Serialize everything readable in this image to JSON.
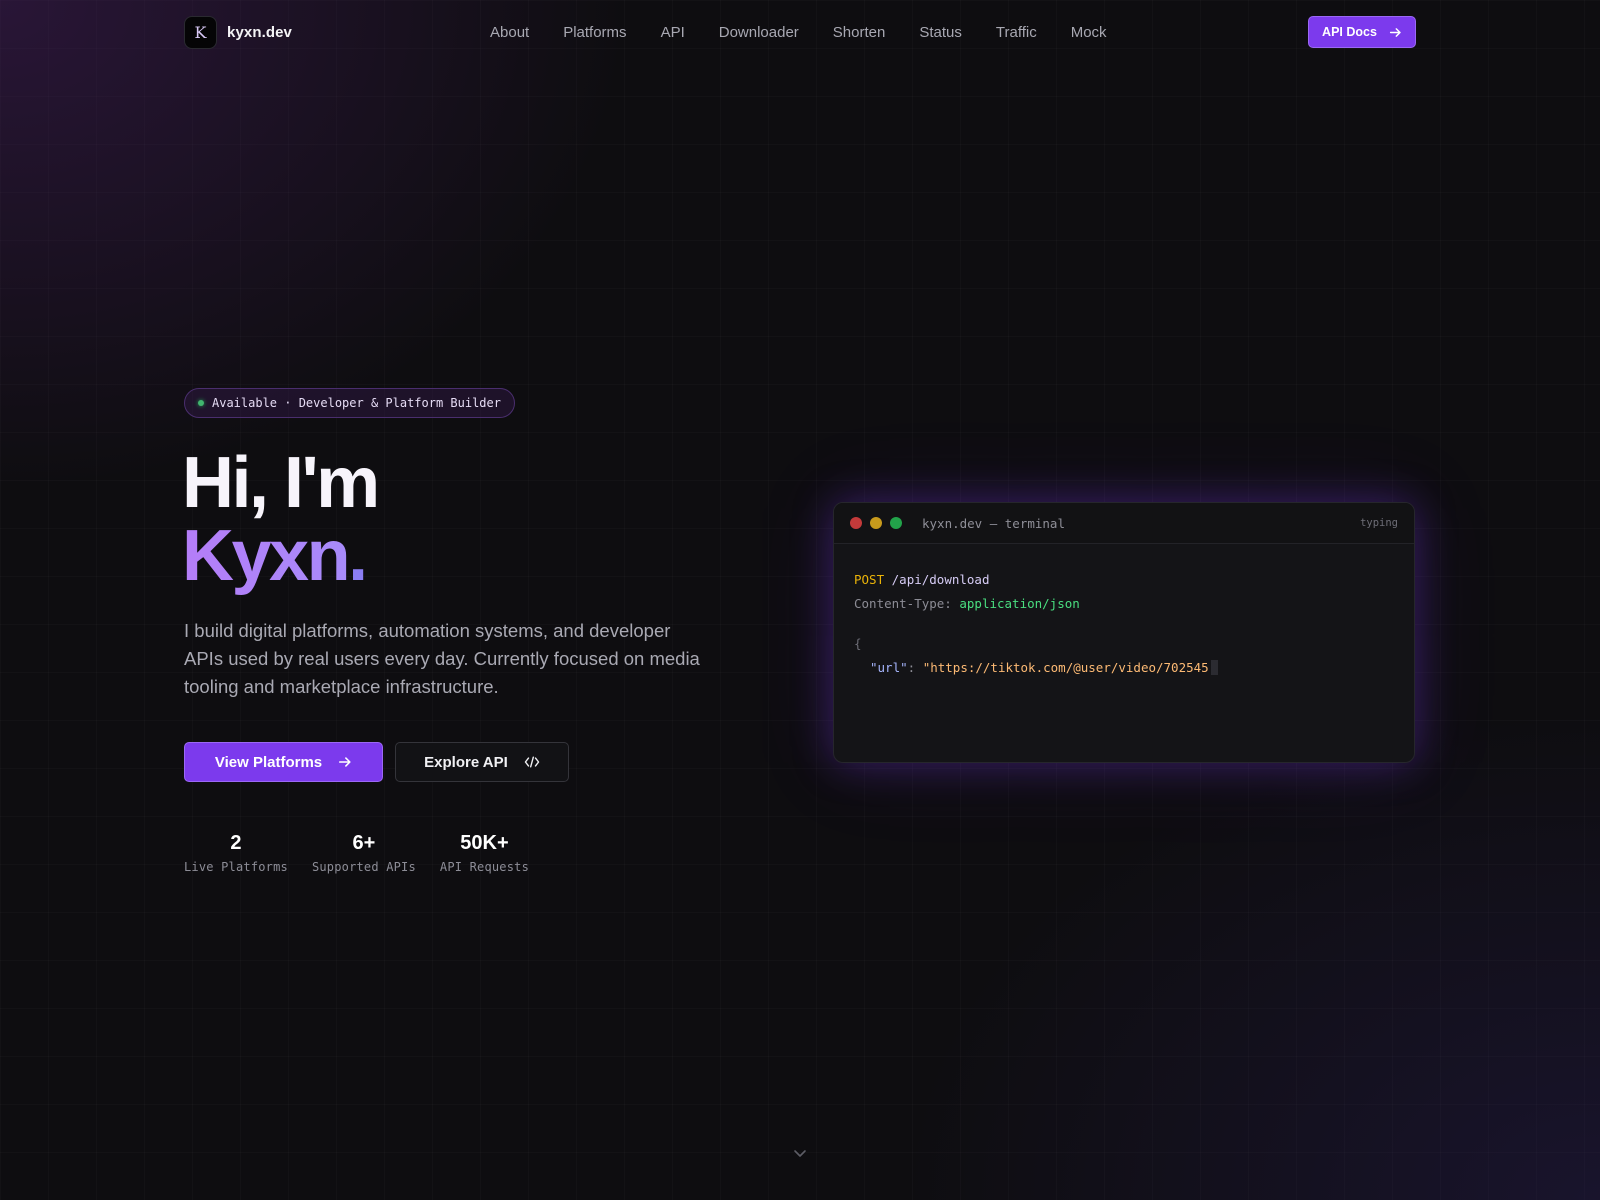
{
  "nav": {
    "brand_name": "kyxn.dev",
    "brand_logo_letter": "K",
    "links": [
      "About",
      "Platforms",
      "API",
      "Downloader",
      "Shorten",
      "Status",
      "Traffic",
      "Mock"
    ],
    "cta_label": "API Docs"
  },
  "badge": {
    "text": "Available · Developer & Platform Builder"
  },
  "hero": {
    "line1": "Hi, I'm",
    "name": "Kyxn",
    "name_suffix": ".",
    "description": "I build digital platforms, automation systems, and developer APIs used by real users every day. Currently focused on media tooling and marketplace infrastructure.",
    "primary_button": "View Platforms",
    "secondary_button": "Explore API"
  },
  "stats": [
    {
      "value": "2",
      "label": "Live Platforms"
    },
    {
      "value": "6+",
      "label": "Supported APIs"
    },
    {
      "value": "50K+",
      "label": "API Requests"
    }
  ],
  "terminal": {
    "title": "kyxn.dev — terminal",
    "status": "typing",
    "method": "POST",
    "path": "/api/download",
    "header_key": "Content-Type:",
    "header_value": "application/json",
    "open_brace": "{",
    "json_key": "\"url\"",
    "json_colon": ":",
    "json_value": "\"https://tiktok.com/@user/video/702545"
  },
  "colors": {
    "accent": "#7c3aed",
    "accent_light": "#a78bfa",
    "background": "#0e0d10",
    "status_dot": "#4ade80"
  },
  "icons": {
    "cta": "arrow-right-icon",
    "secondary": "code-icon",
    "scroll": "chevron-down-icon"
  }
}
